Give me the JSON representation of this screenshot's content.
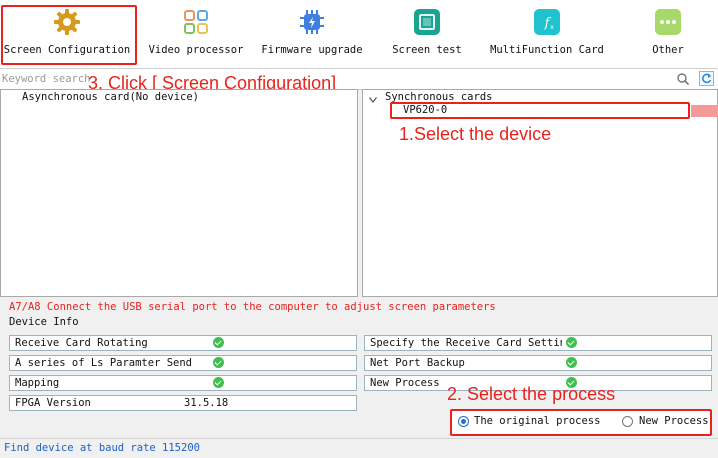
{
  "toolbar": {
    "items": [
      {
        "label": "Screen Configuration",
        "icon": "gear-icon"
      },
      {
        "label": "Video processor",
        "icon": "grid-icon"
      },
      {
        "label": "Firmware upgrade",
        "icon": "chip-icon"
      },
      {
        "label": "Screen test",
        "icon": "screen-icon"
      },
      {
        "label": "MultiFunction Card",
        "icon": "function-icon"
      },
      {
        "label": "Other",
        "icon": "more-icon"
      }
    ]
  },
  "search": {
    "placeholder": "Keyword search"
  },
  "left_panel": {
    "item": "Asynchronous card(No device)"
  },
  "right_panel": {
    "group": "Synchronous cards",
    "device": "VP620-0"
  },
  "annotations": {
    "step1": "1.Select the device",
    "step2": "2. Select the process",
    "step3": "3. Click [ Screen Configuration]"
  },
  "device_info": {
    "warning": "A7/A8 Connect the USB serial port to the computer to adjust screen parameters",
    "title": "Device Info",
    "left_rows": [
      {
        "label": "Receive Card Rotating",
        "value": ""
      },
      {
        "label": "A series of Ls Paramter Send",
        "value": ""
      },
      {
        "label": "Mapping",
        "value": ""
      },
      {
        "label": "FPGA Version",
        "value": "31.5.18"
      }
    ],
    "right_rows": [
      {
        "label": "Specify the Receive Card Setting",
        "value": ""
      },
      {
        "label": "Net Port Backup",
        "value": ""
      },
      {
        "label": "New Process",
        "value": ""
      }
    ]
  },
  "process": {
    "original": "The original process",
    "new": "New Process",
    "selected": "original"
  },
  "status_bar": {
    "text": "Find device at baud rate 115200"
  },
  "colors": {
    "annotation_red": "#e8231d",
    "check_green": "#3fbf4d",
    "radio_blue": "#1e6fd0"
  }
}
